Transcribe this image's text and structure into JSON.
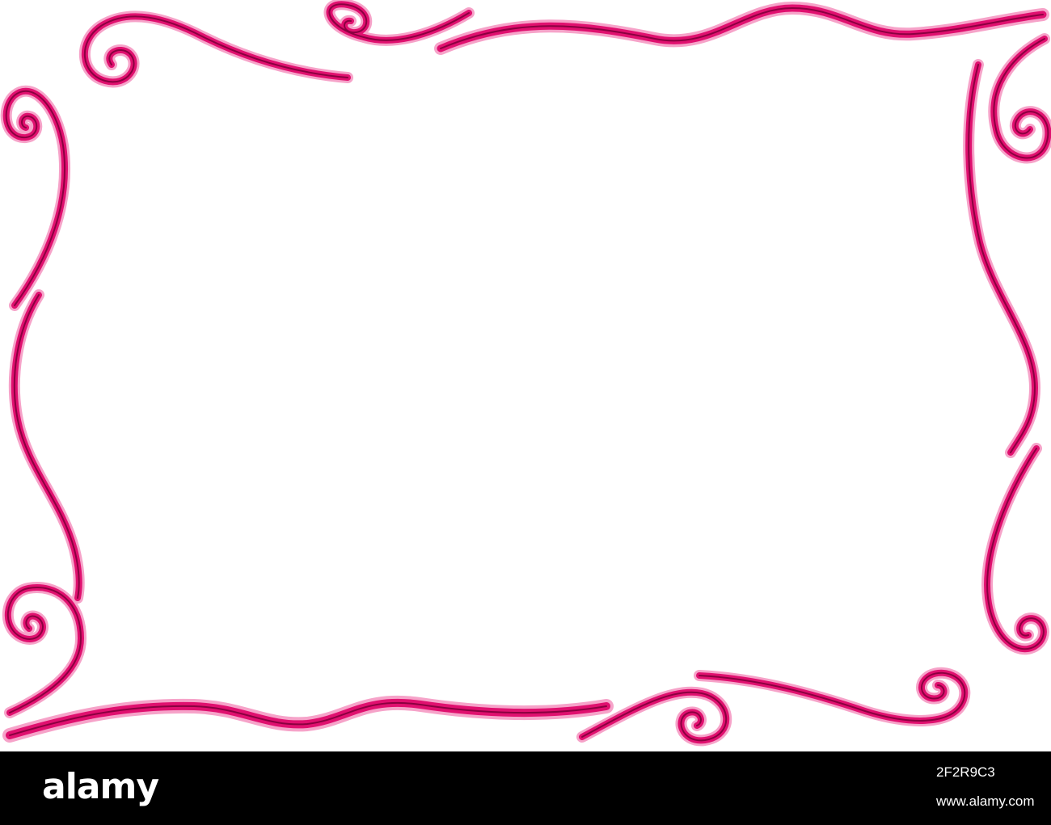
{
  "colors": {
    "frame_main": "#e0106f",
    "frame_light": "#f6a3c9",
    "frame_dark": "#8a0040",
    "background": "#ffffff",
    "footer_bg": "#000000",
    "footer_text": "#ffffff"
  },
  "frame": {
    "style": "ornamental swirl border",
    "icon": "swirl-frame-icon"
  },
  "footer": {
    "logo_text": "alamy",
    "image_id": "2F2R9C3",
    "url": "www.alamy.com"
  }
}
